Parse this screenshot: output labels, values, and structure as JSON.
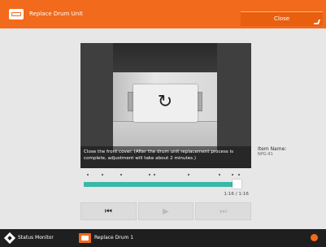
{
  "title": "Replace Drum Unit",
  "close_label": "Close",
  "video": {
    "caption": "Close the front cover. (After the drum unit replacement process is complete, adjustment will take about 2 minutes.)",
    "replay_icon": "replay-icon"
  },
  "item": {
    "label": "Item Name:",
    "value": "NPG-91"
  },
  "playback": {
    "progress": 0.97,
    "time": "1:16 / 1:16",
    "controls": [
      {
        "name": "rewind-to-start-icon",
        "enabled": true
      },
      {
        "name": "play-icon",
        "enabled": false
      },
      {
        "name": "skip-next-icon",
        "enabled": false
      }
    ]
  },
  "statusbar": {
    "status_monitor": "Status Monitor",
    "replace_item": "Replace Drum 1"
  },
  "colors": {
    "accent": "#f26a1b",
    "progress": "#39b7a7"
  }
}
